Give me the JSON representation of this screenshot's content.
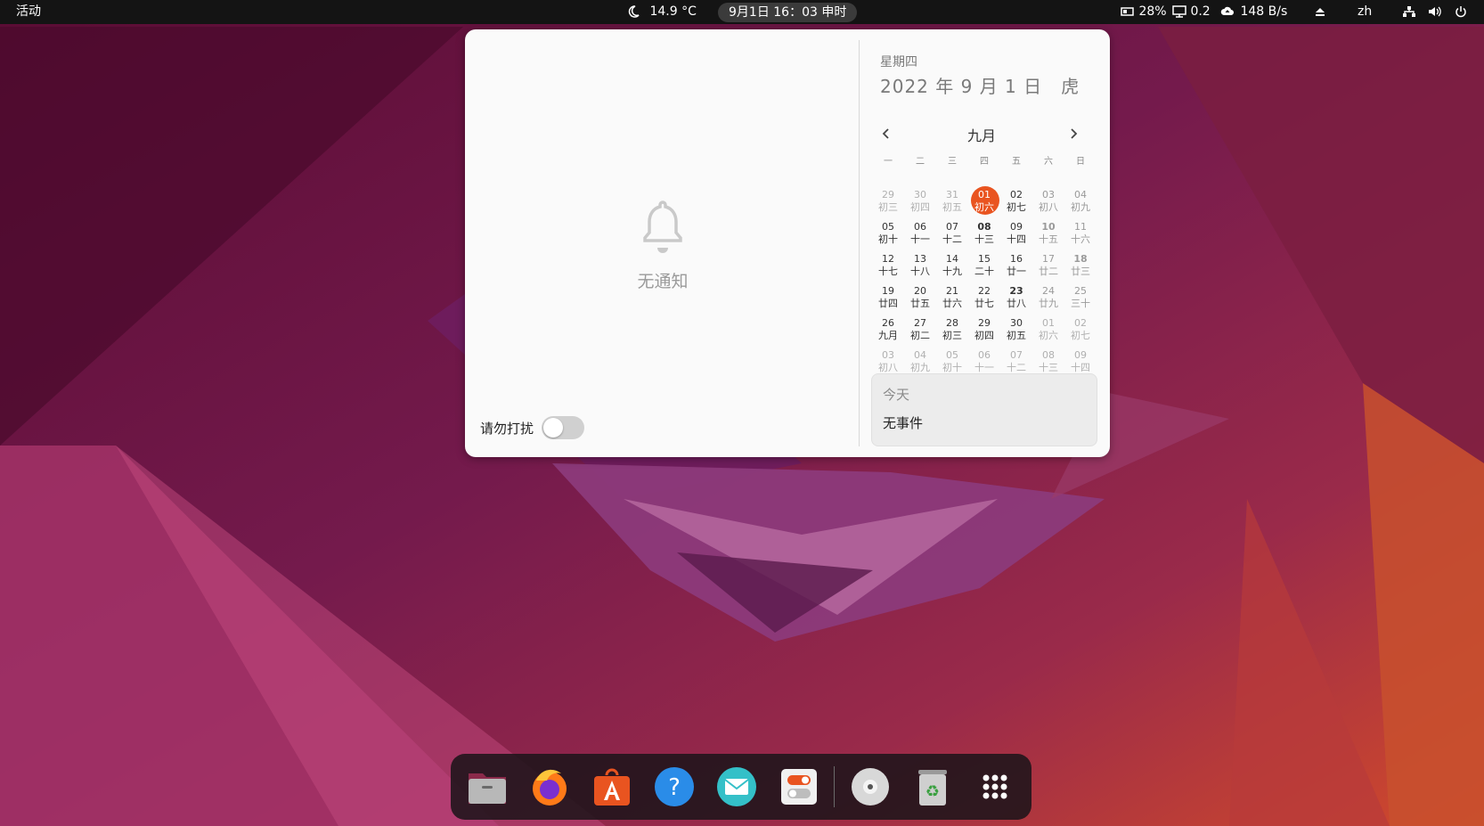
{
  "topbar": {
    "activities": "活动",
    "weather": "14.9 °C",
    "clock": "9月1日  16：03  申时",
    "battery": "28%",
    "load": "0.2",
    "net_speed": "148 B/s",
    "lang": "zh"
  },
  "notifications": {
    "empty_text": "无通知",
    "dnd_label": "请勿打扰",
    "dnd_on": false
  },
  "calendar": {
    "weekday": "星期四",
    "full_date": "2022 年 9 月 1 日　虎",
    "month": "九月",
    "weekdays": [
      "一",
      "二",
      "三",
      "四",
      "五",
      "六",
      "日"
    ],
    "weeks": [
      [
        [
          "29",
          "初三",
          "muted"
        ],
        [
          "30",
          "初四",
          "muted"
        ],
        [
          "31",
          "初五",
          "muted"
        ],
        [
          "01",
          "初六",
          "today"
        ],
        [
          "02",
          "初七",
          ""
        ],
        [
          "03",
          "初八",
          "weekend"
        ],
        [
          "04",
          "初九",
          "weekend"
        ]
      ],
      [
        [
          "05",
          "初十",
          ""
        ],
        [
          "06",
          "十一",
          ""
        ],
        [
          "07",
          "十二",
          ""
        ],
        [
          "08",
          "十三",
          "bold"
        ],
        [
          "09",
          "十四",
          ""
        ],
        [
          "10",
          "十五",
          "weekend bold"
        ],
        [
          "11",
          "十六",
          "weekend"
        ]
      ],
      [
        [
          "12",
          "十七",
          ""
        ],
        [
          "13",
          "十八",
          ""
        ],
        [
          "14",
          "十九",
          ""
        ],
        [
          "15",
          "二十",
          ""
        ],
        [
          "16",
          "廿一",
          ""
        ],
        [
          "17",
          "廿二",
          "weekend"
        ],
        [
          "18",
          "廿三",
          "weekend bold"
        ]
      ],
      [
        [
          "19",
          "廿四",
          ""
        ],
        [
          "20",
          "廿五",
          ""
        ],
        [
          "21",
          "廿六",
          ""
        ],
        [
          "22",
          "廿七",
          ""
        ],
        [
          "23",
          "廿八",
          "bold"
        ],
        [
          "24",
          "廿九",
          "weekend"
        ],
        [
          "25",
          "三十",
          "weekend"
        ]
      ],
      [
        [
          "26",
          "九月",
          ""
        ],
        [
          "27",
          "初二",
          ""
        ],
        [
          "28",
          "初三",
          ""
        ],
        [
          "29",
          "初四",
          ""
        ],
        [
          "30",
          "初五",
          ""
        ],
        [
          "01",
          "初六",
          "muted"
        ],
        [
          "02",
          "初七",
          "muted"
        ]
      ],
      [
        [
          "03",
          "初八",
          "muted"
        ],
        [
          "04",
          "初九",
          "muted"
        ],
        [
          "05",
          "初十",
          "muted"
        ],
        [
          "06",
          "十一",
          "muted"
        ],
        [
          "07",
          "十二",
          "muted"
        ],
        [
          "08",
          "十三",
          "muted"
        ],
        [
          "09",
          "十四",
          "muted"
        ]
      ]
    ],
    "events_title": "今天",
    "events_empty": "无事件"
  },
  "dock": {
    "apps": [
      "files-icon",
      "firefox-icon",
      "app-center-icon",
      "help-icon",
      "mail-icon",
      "settings-toggle-icon",
      "disc-icon",
      "trash-icon",
      "show-apps-icon"
    ]
  }
}
